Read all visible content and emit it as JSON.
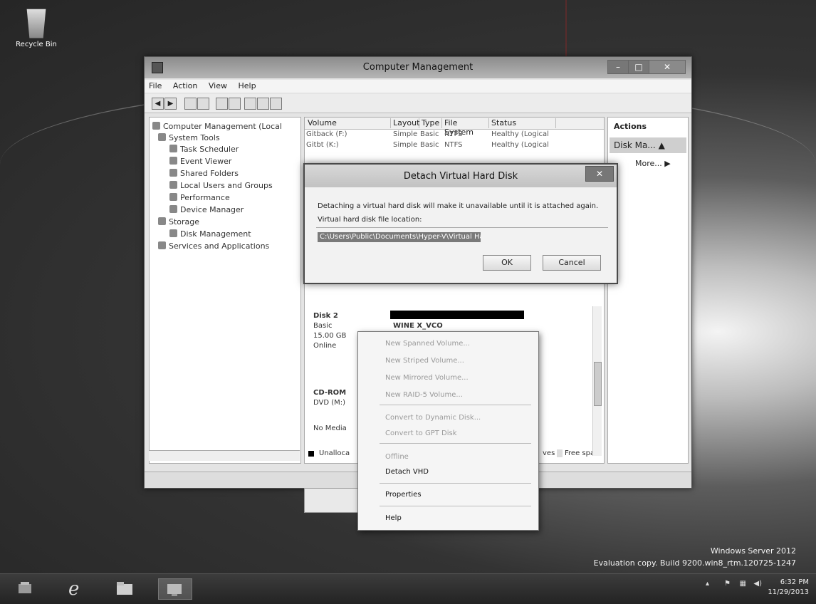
{
  "desktop": {
    "recycle_bin_label": "Recycle Bin",
    "watermark_line1": "Windows Server 2012",
    "watermark_line2": "Evaluation copy. Build 9200.win8_rtm.120725-1247"
  },
  "window": {
    "title": "Computer Management",
    "menu": [
      "File",
      "Action",
      "View",
      "Help"
    ],
    "controls": {
      "minimize": "–",
      "maximize": "□",
      "close": "✕"
    }
  },
  "tree": {
    "root": "Computer Management (Local",
    "system_tools": "System Tools",
    "task_scheduler": "Task Scheduler",
    "event_viewer": "Event Viewer",
    "shared_folders": "Shared Folders",
    "local_users": "Local Users and Groups",
    "performance": "Performance",
    "device_manager": "Device Manager",
    "storage": "Storage",
    "disk_management": "Disk Management",
    "services": "Services and Applications"
  },
  "volume_table": {
    "columns": [
      "Volume",
      "Layout",
      "Type",
      "File System",
      "Status"
    ],
    "rows": [
      [
        "Gitback (F:)",
        "Simple",
        "Basic",
        "NTFS",
        "Healthy (Logical"
      ],
      [
        "Gitbt (K:)",
        "Simple",
        "Basic",
        "NTFS",
        "Healthy (Logical"
      ]
    ]
  },
  "actions": {
    "header": "Actions",
    "selected": "Disk Ma...",
    "more": "More..."
  },
  "disk_panel": {
    "disk2_name": "Disk 2",
    "disk2_type": "Basic",
    "disk2_size": "15.00 GB",
    "disk2_status": "Online",
    "disk2_partition": "WINE X_VCO",
    "cdrom_name": "CD-ROM",
    "cdrom_drive": "DVD (M:)",
    "cdrom_media": "No Media",
    "legend_unallocated": "Unalloca",
    "legend_free": "Free spa",
    "legend_volumes": "ves"
  },
  "dialog": {
    "title": "Detach Virtual Hard Disk",
    "close": "✕",
    "message": "Detaching a virtual hard disk will make it unavailable until it is attached again.",
    "location_label": "Virtual hard disk file location:",
    "location_value": "C:\\Users\\Public\\Documents\\Hyper-V\\Virtual Hard Disks\\Git.VHD",
    "ok": "OK",
    "cancel": "Cancel"
  },
  "context_menu": {
    "items": [
      {
        "label": "New Spanned Volume...",
        "enabled": false
      },
      {
        "label": "New Striped Volume...",
        "enabled": false
      },
      {
        "label": "New Mirrored Volume...",
        "enabled": false
      },
      {
        "label": "New RAID-5 Volume...",
        "enabled": false
      },
      {
        "label": "Convert to Dynamic Disk...",
        "enabled": false
      },
      {
        "label": "Convert to GPT Disk",
        "enabled": false
      },
      {
        "label": "Offline",
        "enabled": false
      },
      {
        "label": "Detach VHD",
        "enabled": true
      },
      {
        "label": "Properties",
        "enabled": true
      },
      {
        "label": "Help",
        "enabled": true
      }
    ]
  },
  "taskbar": {
    "time": "6:32 PM",
    "date": "11/29/2013"
  }
}
